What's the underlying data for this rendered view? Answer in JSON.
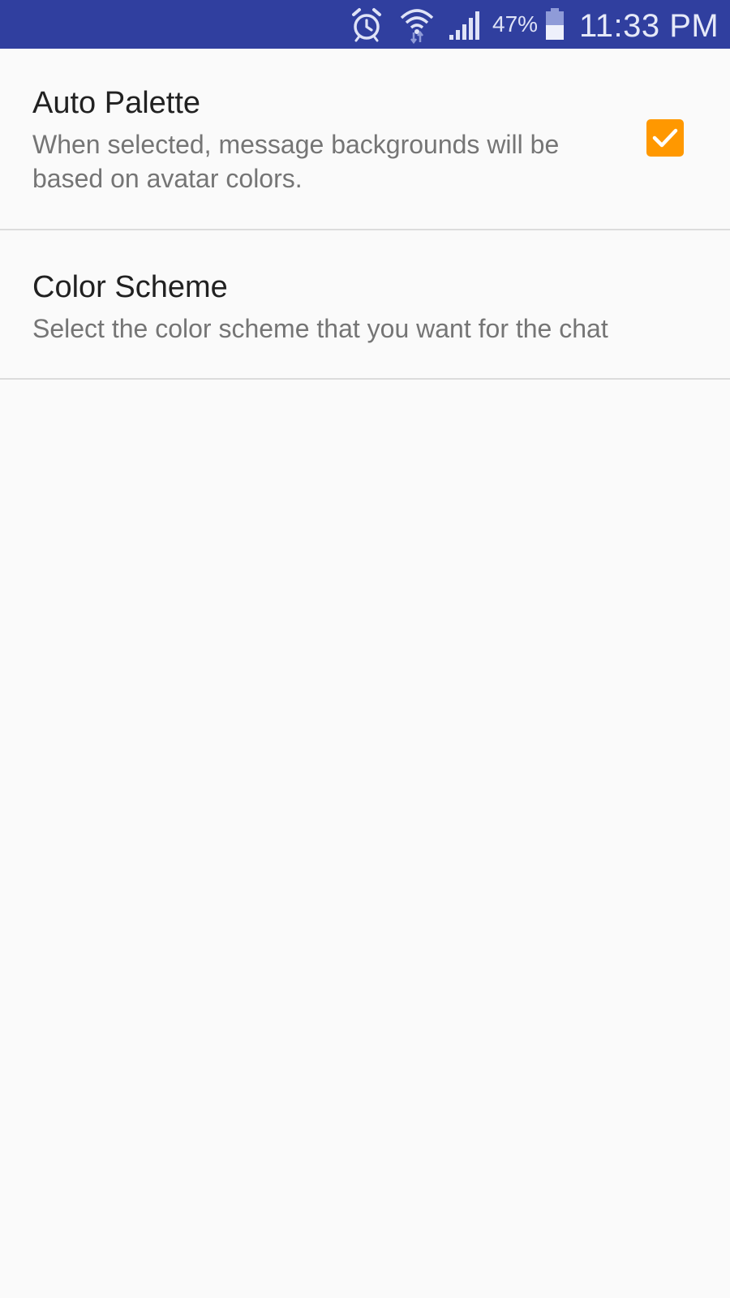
{
  "status_bar": {
    "battery_percent": "47%",
    "time": "11:33 PM",
    "icons": [
      "alarm-icon",
      "wifi-icon",
      "signal-icon",
      "battery-icon"
    ],
    "background_color": "#303f9f"
  },
  "preferences": {
    "auto_palette": {
      "title": "Auto Palette",
      "summary": "When selected, message backgrounds will be based on avatar colors.",
      "checked": true,
      "accent_color": "#ff9800"
    },
    "color_scheme": {
      "title": "Color Scheme",
      "summary": "Select the color scheme that you want for the chat"
    }
  }
}
